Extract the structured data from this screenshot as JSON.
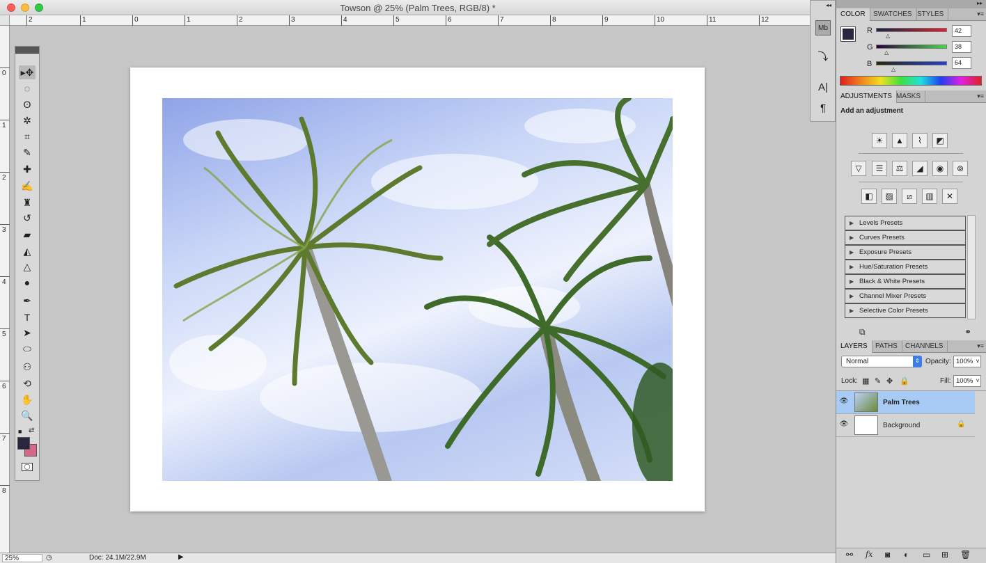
{
  "window": {
    "title": "Towson @ 25% (Palm Trees, RGB/8) *"
  },
  "rulers": {
    "horizontal": [
      "2",
      "1",
      "0",
      "1",
      "2",
      "3",
      "4",
      "5",
      "6",
      "7",
      "8",
      "9",
      "10",
      "11",
      "12"
    ],
    "vertical": [
      "0",
      "1",
      "2",
      "3",
      "4",
      "5",
      "6",
      "7",
      "8"
    ]
  },
  "tools": [
    {
      "icon": "move-icon",
      "glyph": "▸✥"
    },
    {
      "icon": "marquee-icon",
      "glyph": "◌"
    },
    {
      "icon": "lasso-icon",
      "glyph": "ʘ"
    },
    {
      "icon": "magic-wand-icon",
      "glyph": "✲"
    },
    {
      "icon": "crop-icon",
      "glyph": "⌗"
    },
    {
      "icon": "eyedropper-icon",
      "glyph": "✎"
    },
    {
      "icon": "healing-brush-icon",
      "glyph": "✚"
    },
    {
      "icon": "brush-icon",
      "glyph": "✍"
    },
    {
      "icon": "clone-stamp-icon",
      "glyph": "♜"
    },
    {
      "icon": "history-brush-icon",
      "glyph": "↺"
    },
    {
      "icon": "eraser-icon",
      "glyph": "▰"
    },
    {
      "icon": "paint-bucket-icon",
      "glyph": "◭"
    },
    {
      "icon": "blur-icon",
      "glyph": "△"
    },
    {
      "icon": "dodge-icon",
      "glyph": "●"
    },
    {
      "icon": "pen-icon",
      "glyph": "✒"
    },
    {
      "icon": "type-icon",
      "glyph": "T"
    },
    {
      "icon": "path-selection-icon",
      "glyph": "➤"
    },
    {
      "icon": "ellipse-icon",
      "glyph": "⬭"
    },
    {
      "icon": "3d-object-icon",
      "glyph": "⚇"
    },
    {
      "icon": "3d-rotate-icon",
      "glyph": "⟲"
    },
    {
      "icon": "hand-icon",
      "glyph": "✋"
    },
    {
      "icon": "zoom-icon",
      "glyph": "🔍"
    }
  ],
  "colors": {
    "foreground": "#2a2640",
    "background": "#d6678a",
    "selection": "#a8cbf5"
  },
  "status": {
    "zoom": "25%",
    "doc": "Doc: 24.1M/22.9M"
  },
  "color_panel": {
    "tabs": [
      "COLOR",
      "SWATCHES",
      "STYLES"
    ],
    "channels": [
      {
        "label": "R",
        "value": "42"
      },
      {
        "label": "G",
        "value": "38"
      },
      {
        "label": "B",
        "value": "64"
      }
    ]
  },
  "adjustments_panel": {
    "tabs": [
      "ADJUSTMENTS",
      "MASKS"
    ],
    "heading": "Add an adjustment",
    "presets": [
      "Levels Presets",
      "Curves Presets",
      "Exposure Presets",
      "Hue/Saturation Presets",
      "Black & White Presets",
      "Channel Mixer Presets",
      "Selective Color Presets"
    ]
  },
  "layers_panel": {
    "tabs": [
      "LAYERS",
      "PATHS",
      "CHANNELS"
    ],
    "blend_mode": "Normal",
    "opacity_label": "Opacity:",
    "opacity": "100%",
    "lock_label": "Lock:",
    "fill_label": "Fill:",
    "fill": "100%",
    "layers": [
      {
        "name": "Palm Trees",
        "selected": true
      },
      {
        "name": "Background",
        "selected": false
      }
    ]
  },
  "dock": {
    "type_label": "A|",
    "paragraph_label": "¶",
    "mini_bridge_label": "Mb"
  }
}
